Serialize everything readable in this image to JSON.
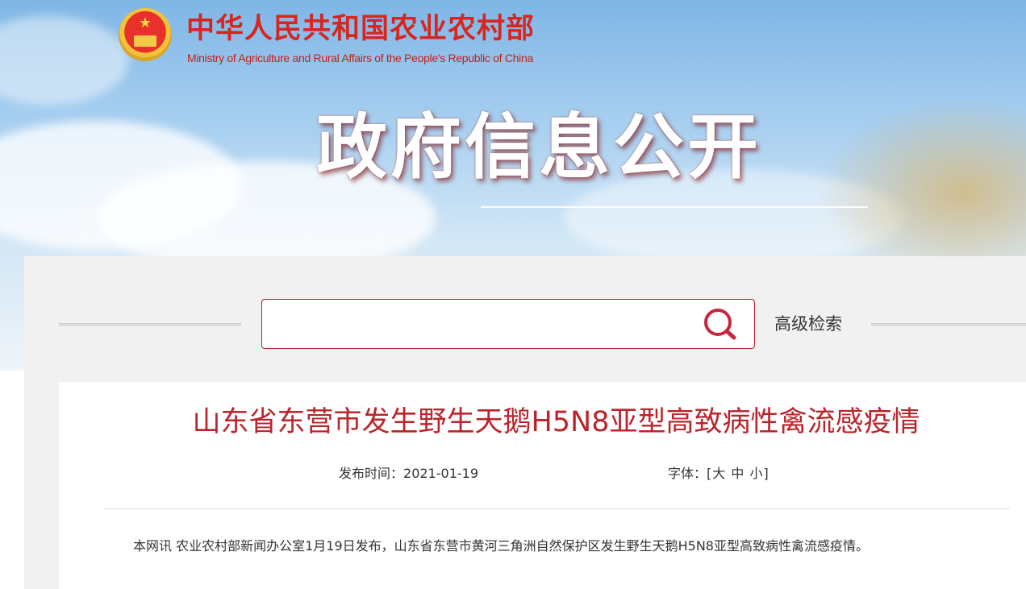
{
  "header": {
    "ministry_cn": "中华人民共和国农业农村部",
    "ministry_en": "Ministry of Agriculture and Rural Affairs of the People's Republic of China",
    "section_title": "政府信息公开",
    "emblem_icon": "national-emblem-icon"
  },
  "search": {
    "placeholder": "",
    "value": "",
    "icon": "search-icon",
    "advanced_label": "高级检索"
  },
  "article": {
    "title": "山东省东营市发生野生天鹅H5N8亚型高致病性禽流感疫情",
    "publish_label": "发布时间：",
    "publish_date": "2021-01-19",
    "font_label": "字体：",
    "font_open": "[",
    "font_large": "大",
    "font_medium": "中",
    "font_small": "小",
    "font_close": "]",
    "body": "本网讯  农业农村部新闻办公室1月19日发布，山东省东营市黄河三角洲自然保护区发生野生天鹅H5N8亚型高致病性禽流感疫情。"
  },
  "colors": {
    "brand_red": "#d7261f",
    "title_red": "#b9252b",
    "search_border": "#b8212a",
    "panel_bg": "#f1f1f1"
  }
}
